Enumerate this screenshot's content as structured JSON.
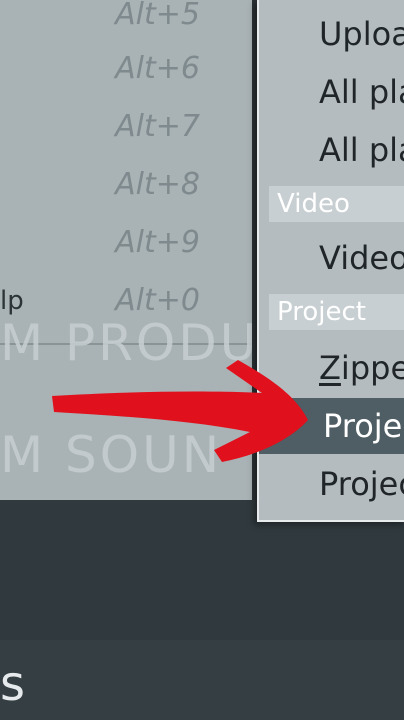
{
  "left_menu": {
    "shortcuts": [
      "Alt+5",
      "Alt+6",
      "Alt+7",
      "Alt+8",
      "Alt+9",
      "Alt+0"
    ],
    "partial_label": "lp",
    "watermark_line1": "M PRODU",
    "watermark_line2": "M SOUN"
  },
  "right_menu": {
    "items": [
      {
        "label": "Uploa"
      },
      {
        "label": "All pla"
      },
      {
        "label": "All pla"
      }
    ],
    "section_video": "Video",
    "video_item": "Video",
    "section_project": "Project",
    "project_items": [
      {
        "label_first": "Z",
        "label_rest": "ippe"
      },
      {
        "label": "Proje"
      },
      {
        "label": "Projec"
      }
    ]
  },
  "bottom": {
    "glyph": "s"
  },
  "colors": {
    "arrow": "#e0101c",
    "highlight": "#4f5d64"
  }
}
